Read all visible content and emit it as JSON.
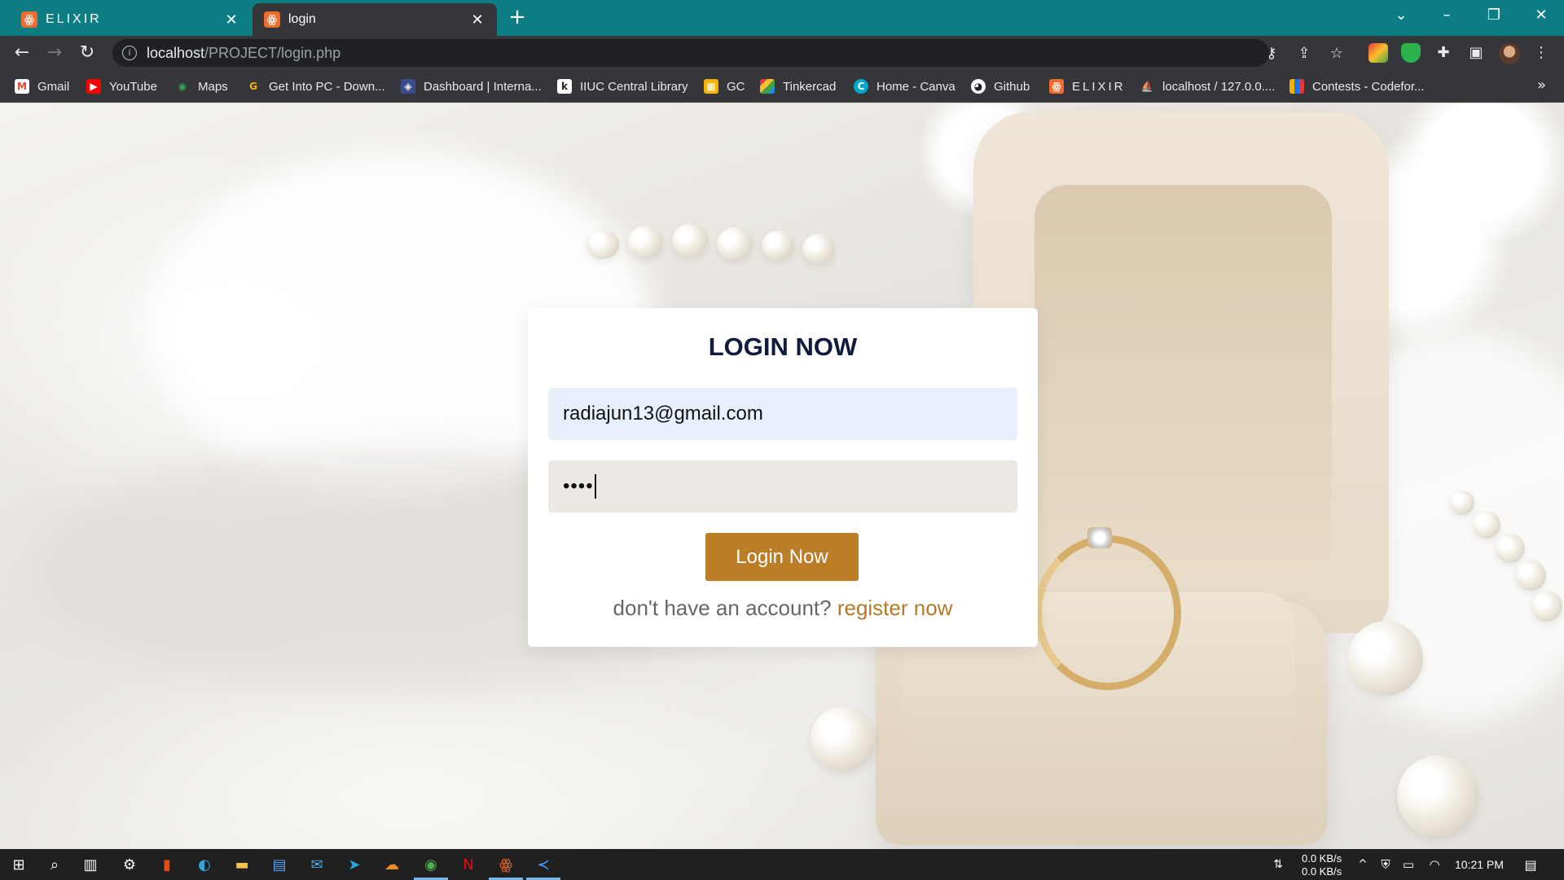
{
  "browser": {
    "tabs": [
      {
        "title": "ELIXIR",
        "favicon": "xampp-icon",
        "active": false
      },
      {
        "title": "login",
        "favicon": "xampp-icon",
        "active": true
      }
    ],
    "address": {
      "host": "localhost",
      "path": "/PROJECT/login.php"
    },
    "bookmarks": [
      {
        "label": "Gmail",
        "icon": "gmail-icon",
        "color": "#ea4335"
      },
      {
        "label": "YouTube",
        "icon": "youtube-icon",
        "color": "#ff0000"
      },
      {
        "label": "Maps",
        "icon": "maps-icon",
        "color": "#34a853"
      },
      {
        "label": "Get Into PC - Down...",
        "icon": "getintopc-icon",
        "color": "#f4b400"
      },
      {
        "label": "Dashboard | Interna...",
        "icon": "iiuc-icon",
        "color": "#3b4a8a"
      },
      {
        "label": "IIUC Central Library",
        "icon": "library-icon",
        "color": "#ffffff"
      },
      {
        "label": "GC",
        "icon": "classroom-icon",
        "color": "#f4b400"
      },
      {
        "label": "Tinkercad",
        "icon": "tinkercad-icon",
        "color": "#1e88e5"
      },
      {
        "label": "Home - Canva",
        "icon": "canva-icon",
        "color": "#00c4cc"
      },
      {
        "label": "Github",
        "icon": "github-icon",
        "color": "#ffffff"
      },
      {
        "label": "ELIXIR",
        "icon": "xampp-icon",
        "color": "#ef6b2e"
      },
      {
        "label": "localhost / 127.0.0....",
        "icon": "phpmyadmin-icon",
        "color": "#f29111"
      },
      {
        "label": "Contests - Codefor...",
        "icon": "codeforces-icon",
        "color": "#1a73e8"
      }
    ]
  },
  "login": {
    "title": "LOGIN NOW",
    "email_value": "radiajun13@gmail.com",
    "password_mask": "••••",
    "submit_label": "Login Now",
    "register_prompt": "don't have an account?",
    "register_link": "register now"
  },
  "colors": {
    "tabbar": "#0c7e83",
    "button": "#bb7d28",
    "link": "#b67925",
    "title": "#101b3d"
  },
  "taskbar": {
    "net_down": "0.0 KB/s",
    "net_up": "0.0 KB/s",
    "time": "10:21 PM"
  }
}
